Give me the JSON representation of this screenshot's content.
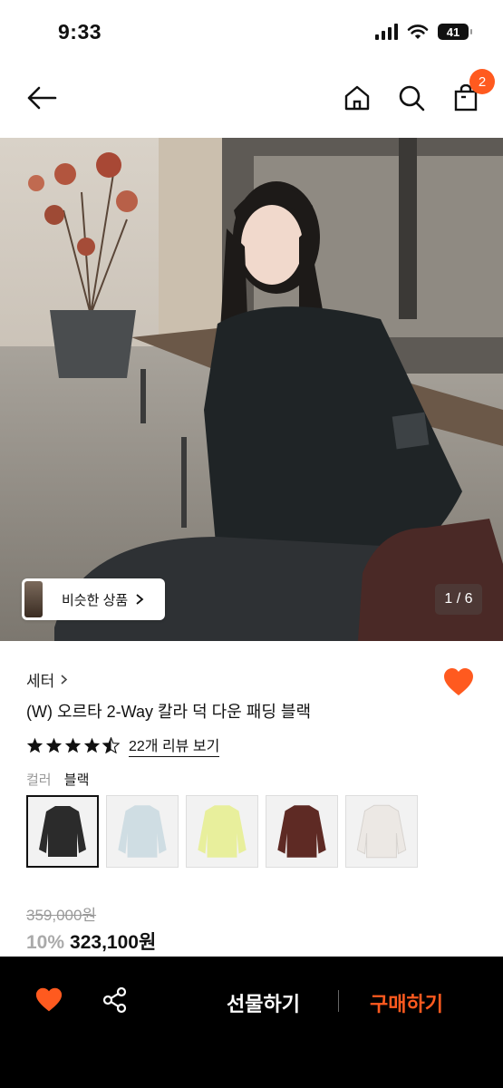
{
  "status_bar": {
    "time": "9:33",
    "battery": "41"
  },
  "header": {
    "cart_count": "2"
  },
  "gallery": {
    "similar_label": "비슷한 상품",
    "page_indicator": "1 / 6"
  },
  "product": {
    "category": "세터",
    "title": "(W) 오르타 2-Way 칼라 덕 다운 패딩 블랙",
    "rating": 4.5,
    "review_link": "22개 리뷰 보기",
    "color_label": "컬러",
    "color_value": "블랙",
    "swatches": [
      {
        "name": "black",
        "color": "#2b2b2b"
      },
      {
        "name": "light-blue",
        "color": "#cfdde3"
      },
      {
        "name": "yellow",
        "color": "#e8ef9c"
      },
      {
        "name": "brown",
        "color": "#5e2a24"
      },
      {
        "name": "ivory",
        "color": "#ece8e4"
      }
    ],
    "original_price": "359,000원",
    "discount": "10%",
    "sale_price": "323,100원"
  },
  "bottom_bar": {
    "gift_label": "선물하기",
    "buy_label": "구매하기"
  },
  "colors": {
    "accent": "#ff5a1f"
  }
}
